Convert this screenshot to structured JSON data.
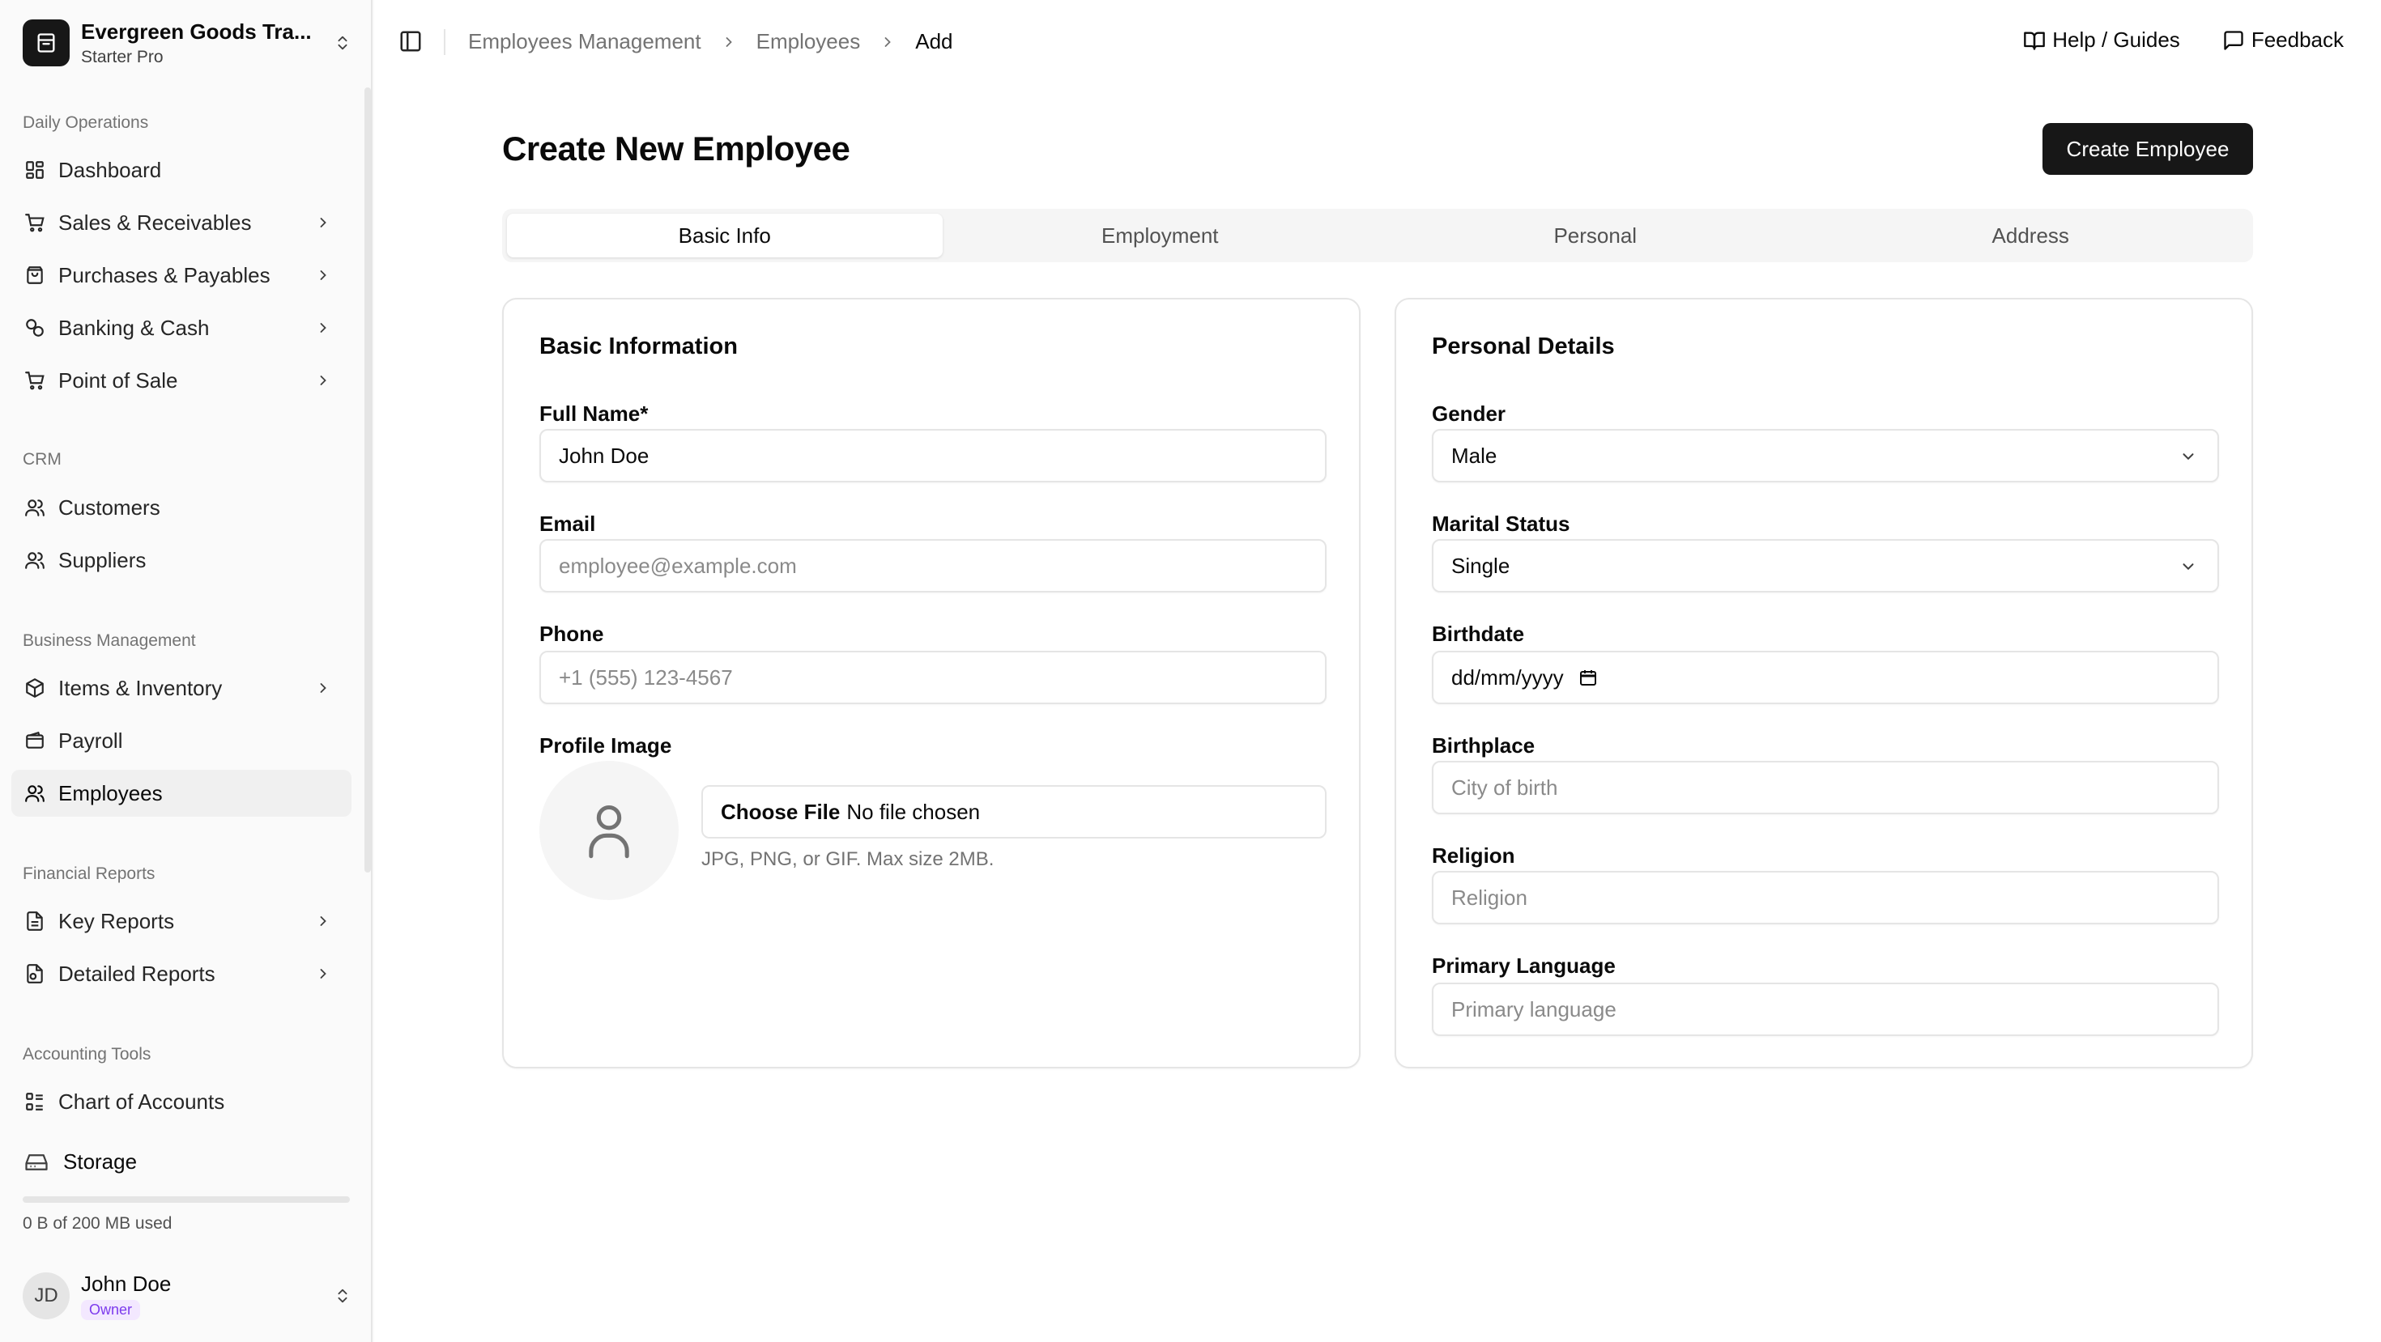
{
  "org": {
    "name": "Evergreen Goods Tra...",
    "plan": "Starter Pro"
  },
  "sidebar": {
    "groups": [
      {
        "label": "Daily Operations"
      },
      {
        "label": "CRM"
      },
      {
        "label": "Business Management"
      },
      {
        "label": "Financial Reports"
      },
      {
        "label": "Accounting Tools"
      }
    ],
    "items": [
      {
        "label": "Dashboard",
        "icon": "dashboard-icon"
      },
      {
        "label": "Sales & Receivables",
        "icon": "cart-icon"
      },
      {
        "label": "Purchases & Payables",
        "icon": "shopping-bag-icon"
      },
      {
        "label": "Banking & Cash",
        "icon": "coins-icon"
      },
      {
        "label": "Point of Sale",
        "icon": "cart-icon"
      },
      {
        "label": "Customers",
        "icon": "users-icon"
      },
      {
        "label": "Suppliers",
        "icon": "users-icon"
      },
      {
        "label": "Items & Inventory",
        "icon": "package-icon"
      },
      {
        "label": "Payroll",
        "icon": "wallet-icon"
      },
      {
        "label": "Employees",
        "icon": "users-icon"
      },
      {
        "label": "Key Reports",
        "icon": "file-text-icon"
      },
      {
        "label": "Detailed Reports",
        "icon": "file-chart-icon"
      },
      {
        "label": "Chart of Accounts",
        "icon": "list-tree-icon"
      }
    ],
    "active": "Employees",
    "storage": {
      "label": "Storage",
      "used_text": "0 B of 200 MB used",
      "used_fraction": 0
    }
  },
  "user": {
    "initials": "JD",
    "name": "John Doe",
    "role": "Owner"
  },
  "breadcrumb": [
    "Employees Management",
    "Employees",
    "Add"
  ],
  "top_actions": {
    "help": "Help / Guides",
    "feedback": "Feedback"
  },
  "page": {
    "title": "Create New Employee",
    "create_button": "Create Employee",
    "tabs": [
      "Basic Info",
      "Employment",
      "Personal",
      "Address"
    ],
    "active_tab": "Basic Info"
  },
  "basic_info": {
    "title": "Basic Information",
    "full_name_label": "Full Name*",
    "full_name_value": "John Doe",
    "email_label": "Email",
    "email_placeholder": "employee@example.com",
    "phone_label": "Phone",
    "phone_placeholder": "+1 (555) 123-4567",
    "profile_label": "Profile Image",
    "file_button": "Choose File",
    "file_status": "No file chosen",
    "file_hint": "JPG, PNG, or GIF. Max size 2MB."
  },
  "personal_details": {
    "title": "Personal Details",
    "gender_label": "Gender",
    "gender_value": "Male",
    "marital_label": "Marital Status",
    "marital_value": "Single",
    "birthdate_label": "Birthdate",
    "birthdate_placeholder": "dd/mm/yyyy",
    "birthplace_label": "Birthplace",
    "birthplace_placeholder": "City of birth",
    "religion_label": "Religion",
    "religion_placeholder": "Religion",
    "language_label": "Primary Language",
    "language_placeholder": "Primary language"
  }
}
